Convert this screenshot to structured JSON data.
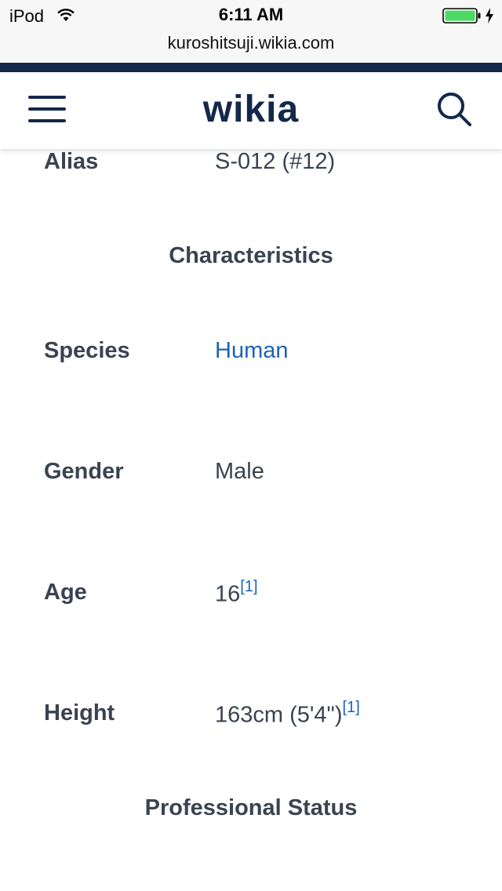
{
  "status_bar": {
    "carrier": "iPod",
    "time": "6:11 AM",
    "url": "kuroshitsuji.wikia.com",
    "wifi_icon": "wifi-icon",
    "battery_icon": "battery-icon",
    "battery_color": "#4cd964"
  },
  "header": {
    "logo": "wikia",
    "menu_icon": "hamburger-menu-icon",
    "search_icon": "search-icon",
    "brand_color": "#13284a"
  },
  "infobox": {
    "alias": {
      "label": "Alias",
      "value": "S-012 (#12)"
    },
    "characteristics_title": "Characteristics",
    "species": {
      "label": "Species",
      "value": "Human"
    },
    "gender": {
      "label": "Gender",
      "value": "Male"
    },
    "age": {
      "label": "Age",
      "value": "16",
      "ref": "[1]"
    },
    "height": {
      "label": "Height",
      "value": "163cm (5'4\")",
      "ref": "[1]"
    },
    "professional_status_title": "Professional Status"
  },
  "colors": {
    "text": "#3a4350",
    "link": "#1e63b4"
  }
}
